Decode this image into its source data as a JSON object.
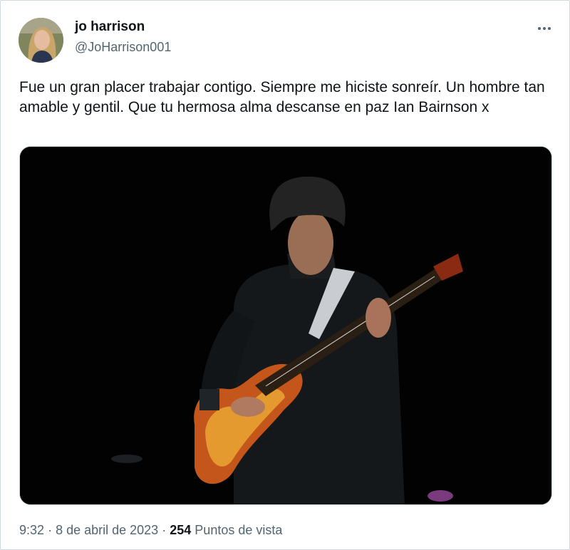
{
  "author": {
    "name": "jo harrison",
    "handle": "@JoHarrison001"
  },
  "tweet": {
    "text": "Fue un gran placer trabajar contigo. Siempre me hiciste sonreír. Un hombre tan amable y gentil. Que tu hermosa alma descanse en paz Ian Bairnson x",
    "time": "9:32",
    "separator1": "·",
    "date": "8 de abril de 2023",
    "separator2": "·",
    "views_count": "254",
    "views_label": "Puntos de vista"
  },
  "icons": {
    "more": "more-horizontal-icon"
  }
}
